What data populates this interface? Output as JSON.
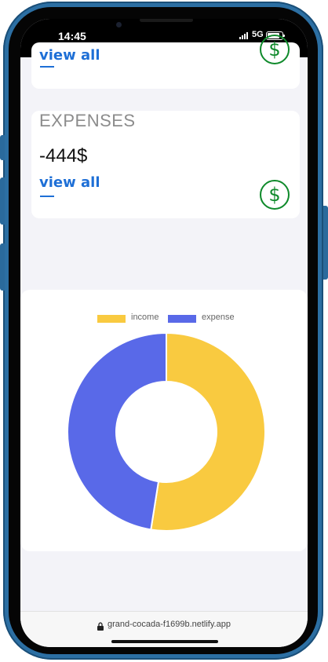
{
  "status_bar": {
    "time": "14:45",
    "network": "5G"
  },
  "income_card": {
    "link_label": "view all",
    "icon": "dollar-circle-icon"
  },
  "expenses_card": {
    "title": "EXPENSES",
    "amount": "-444$",
    "link_label": "view all",
    "icon": "dollar-circle-icon"
  },
  "chart": {
    "legend": [
      {
        "label": "income",
        "color": "#f9ca40"
      },
      {
        "label": "expense",
        "color": "#5969e8"
      }
    ]
  },
  "chart_data": {
    "type": "pie",
    "categories": [
      "income",
      "expense"
    ],
    "values": [
      52.5,
      47.5
    ],
    "donut": true,
    "legend_position": "top",
    "colors": [
      "#f9ca40",
      "#5969e8"
    ]
  },
  "browser": {
    "url": "grand-cocada-f1699b.netlify.app"
  },
  "colors": {
    "accent_blue": "#1e6fd6",
    "icon_green": "#0f8a2b",
    "page_bg": "#f3f3f8"
  }
}
